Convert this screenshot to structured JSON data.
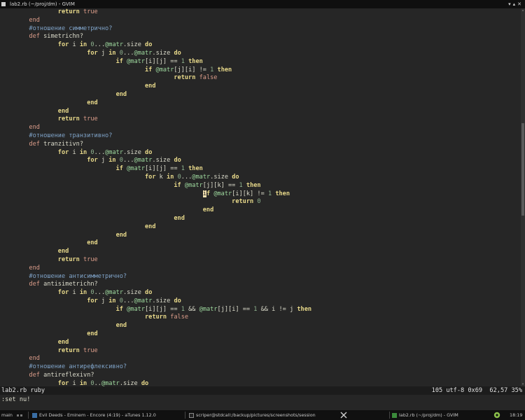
{
  "window": {
    "title": "lab2.rb (~/proj/dm) - GVIM",
    "controls": "▾▴✕"
  },
  "editor": {
    "lines": [
      [
        {
          "t": "                "
        },
        {
          "t": "return",
          "c": "kw"
        },
        {
          "t": " "
        },
        {
          "t": "true",
          "c": "bool"
        }
      ],
      [
        {
          "t": "        "
        },
        {
          "t": "end",
          "c": "bool"
        }
      ],
      [
        {
          "t": "        "
        },
        {
          "t": "#отношение симметрично?",
          "c": "cmt"
        }
      ],
      [
        {
          "t": "        "
        },
        {
          "t": "def",
          "c": "bool"
        },
        {
          "t": " simetrichn?"
        }
      ],
      [
        {
          "t": "                "
        },
        {
          "t": "for",
          "c": "kw"
        },
        {
          "t": " i "
        },
        {
          "t": "in",
          "c": "kw"
        },
        {
          "t": " "
        },
        {
          "t": "0",
          "c": "num"
        },
        {
          "t": "..."
        },
        {
          "t": "@matr",
          "c": "ivar"
        },
        {
          "t": ".size "
        },
        {
          "t": "do",
          "c": "kw"
        }
      ],
      [
        {
          "t": "                        "
        },
        {
          "t": "for",
          "c": "kw"
        },
        {
          "t": " j "
        },
        {
          "t": "in",
          "c": "kw"
        },
        {
          "t": " "
        },
        {
          "t": "0",
          "c": "num"
        },
        {
          "t": "..."
        },
        {
          "t": "@matr",
          "c": "ivar"
        },
        {
          "t": ".size "
        },
        {
          "t": "do",
          "c": "kw"
        }
      ],
      [
        {
          "t": "                                "
        },
        {
          "t": "if",
          "c": "kw"
        },
        {
          "t": " "
        },
        {
          "t": "@matr",
          "c": "ivar"
        },
        {
          "t": "[i][j] == "
        },
        {
          "t": "1",
          "c": "num"
        },
        {
          "t": " "
        },
        {
          "t": "then",
          "c": "kw"
        }
      ],
      [
        {
          "t": "                                        "
        },
        {
          "t": "if",
          "c": "kw"
        },
        {
          "t": " "
        },
        {
          "t": "@matr",
          "c": "ivar"
        },
        {
          "t": "[j][i] != "
        },
        {
          "t": "1",
          "c": "num"
        },
        {
          "t": " "
        },
        {
          "t": "then",
          "c": "kw"
        }
      ],
      [
        {
          "t": "                                                "
        },
        {
          "t": "return",
          "c": "kw"
        },
        {
          "t": " "
        },
        {
          "t": "false",
          "c": "bool"
        }
      ],
      [
        {
          "t": "                                        "
        },
        {
          "t": "end",
          "c": "kw"
        }
      ],
      [
        {
          "t": "                                "
        },
        {
          "t": "end",
          "c": "kw"
        }
      ],
      [
        {
          "t": "                        "
        },
        {
          "t": "end",
          "c": "kw"
        }
      ],
      [
        {
          "t": "                "
        },
        {
          "t": "end",
          "c": "kw"
        }
      ],
      [
        {
          "t": "                "
        },
        {
          "t": "return",
          "c": "kw"
        },
        {
          "t": " "
        },
        {
          "t": "true",
          "c": "bool"
        }
      ],
      [
        {
          "t": "        "
        },
        {
          "t": "end",
          "c": "bool"
        }
      ],
      [
        {
          "t": "        "
        },
        {
          "t": "#отношение транзитивно?",
          "c": "cmt"
        }
      ],
      [
        {
          "t": "        "
        },
        {
          "t": "def",
          "c": "bool"
        },
        {
          "t": " tranzitivn?"
        }
      ],
      [
        {
          "t": "                "
        },
        {
          "t": "for",
          "c": "kw"
        },
        {
          "t": " i "
        },
        {
          "t": "in",
          "c": "kw"
        },
        {
          "t": " "
        },
        {
          "t": "0",
          "c": "num"
        },
        {
          "t": "..."
        },
        {
          "t": "@matr",
          "c": "ivar"
        },
        {
          "t": ".size "
        },
        {
          "t": "do",
          "c": "kw"
        }
      ],
      [
        {
          "t": "                        "
        },
        {
          "t": "for",
          "c": "kw"
        },
        {
          "t": " j "
        },
        {
          "t": "in",
          "c": "kw"
        },
        {
          "t": " "
        },
        {
          "t": "0",
          "c": "num"
        },
        {
          "t": "..."
        },
        {
          "t": "@matr",
          "c": "ivar"
        },
        {
          "t": ".size "
        },
        {
          "t": "do",
          "c": "kw"
        }
      ],
      [
        {
          "t": "                                "
        },
        {
          "t": "if",
          "c": "kw"
        },
        {
          "t": " "
        },
        {
          "t": "@matr",
          "c": "ivar"
        },
        {
          "t": "[i][j] == "
        },
        {
          "t": "1",
          "c": "num"
        },
        {
          "t": " "
        },
        {
          "t": "then",
          "c": "kw"
        }
      ],
      [
        {
          "t": "                                        "
        },
        {
          "t": "for",
          "c": "kw"
        },
        {
          "t": " k "
        },
        {
          "t": "in",
          "c": "kw"
        },
        {
          "t": " "
        },
        {
          "t": "0",
          "c": "num"
        },
        {
          "t": "..."
        },
        {
          "t": "@matr",
          "c": "ivar"
        },
        {
          "t": ".size "
        },
        {
          "t": "do",
          "c": "kw"
        }
      ],
      [
        {
          "t": "                                                "
        },
        {
          "t": "if",
          "c": "kw"
        },
        {
          "t": " "
        },
        {
          "t": "@matr",
          "c": "ivar"
        },
        {
          "t": "[j][k] == "
        },
        {
          "t": "1",
          "c": "num"
        },
        {
          "t": " "
        },
        {
          "t": "then",
          "c": "kw"
        }
      ],
      [
        {
          "t": "                                                        "
        },
        {
          "t": "i",
          "c": "cursor"
        },
        {
          "t": "f",
          "c": "kw"
        },
        {
          "t": " "
        },
        {
          "t": "@matr",
          "c": "ivar"
        },
        {
          "t": "[i][k] != "
        },
        {
          "t": "1",
          "c": "num"
        },
        {
          "t": " "
        },
        {
          "t": "then",
          "c": "kw"
        }
      ],
      [
        {
          "t": "                                                                "
        },
        {
          "t": "return",
          "c": "kw"
        },
        {
          "t": " "
        },
        {
          "t": "0",
          "c": "num"
        }
      ],
      [
        {
          "t": "                                                        "
        },
        {
          "t": "end",
          "c": "kw"
        }
      ],
      [
        {
          "t": "                                                "
        },
        {
          "t": "end",
          "c": "kw"
        }
      ],
      [
        {
          "t": "                                        "
        },
        {
          "t": "end",
          "c": "kw"
        }
      ],
      [
        {
          "t": "                                "
        },
        {
          "t": "end",
          "c": "kw"
        }
      ],
      [
        {
          "t": "                        "
        },
        {
          "t": "end",
          "c": "kw"
        }
      ],
      [
        {
          "t": "                "
        },
        {
          "t": "end",
          "c": "kw"
        }
      ],
      [
        {
          "t": "                "
        },
        {
          "t": "return",
          "c": "kw"
        },
        {
          "t": " "
        },
        {
          "t": "true",
          "c": "bool"
        }
      ],
      [
        {
          "t": "        "
        },
        {
          "t": "end",
          "c": "bool"
        }
      ],
      [
        {
          "t": "        "
        },
        {
          "t": "#отношение антисимметрично?",
          "c": "cmt"
        }
      ],
      [
        {
          "t": "        "
        },
        {
          "t": "def",
          "c": "bool"
        },
        {
          "t": " antisimetrichn?"
        }
      ],
      [
        {
          "t": "                "
        },
        {
          "t": "for",
          "c": "kw"
        },
        {
          "t": " i "
        },
        {
          "t": "in",
          "c": "kw"
        },
        {
          "t": " "
        },
        {
          "t": "0",
          "c": "num"
        },
        {
          "t": "..."
        },
        {
          "t": "@matr",
          "c": "ivar"
        },
        {
          "t": ".size "
        },
        {
          "t": "do",
          "c": "kw"
        }
      ],
      [
        {
          "t": "                        "
        },
        {
          "t": "for",
          "c": "kw"
        },
        {
          "t": " j "
        },
        {
          "t": "in",
          "c": "kw"
        },
        {
          "t": " "
        },
        {
          "t": "0",
          "c": "num"
        },
        {
          "t": "..."
        },
        {
          "t": "@matr",
          "c": "ivar"
        },
        {
          "t": ".size "
        },
        {
          "t": "do",
          "c": "kw"
        }
      ],
      [
        {
          "t": "                                "
        },
        {
          "t": "if",
          "c": "kw"
        },
        {
          "t": " "
        },
        {
          "t": "@matr",
          "c": "ivar"
        },
        {
          "t": "[i][j] == "
        },
        {
          "t": "1",
          "c": "num"
        },
        {
          "t": " && "
        },
        {
          "t": "@matr",
          "c": "ivar"
        },
        {
          "t": "[j][i] == "
        },
        {
          "t": "1",
          "c": "num"
        },
        {
          "t": " && i != j "
        },
        {
          "t": "then",
          "c": "kw"
        }
      ],
      [
        {
          "t": "                                        "
        },
        {
          "t": "return",
          "c": "kw"
        },
        {
          "t": " "
        },
        {
          "t": "false",
          "c": "bool"
        }
      ],
      [
        {
          "t": "                                "
        },
        {
          "t": "end",
          "c": "kw"
        }
      ],
      [
        {
          "t": "                        "
        },
        {
          "t": "end",
          "c": "kw"
        }
      ],
      [
        {
          "t": "                "
        },
        {
          "t": "end",
          "c": "kw"
        }
      ],
      [
        {
          "t": "                "
        },
        {
          "t": "return",
          "c": "kw"
        },
        {
          "t": " "
        },
        {
          "t": "true",
          "c": "bool"
        }
      ],
      [
        {
          "t": "        "
        },
        {
          "t": "end",
          "c": "bool"
        }
      ],
      [
        {
          "t": "        "
        },
        {
          "t": "#отношение антирефлексивно?",
          "c": "cmt"
        }
      ],
      [
        {
          "t": "        "
        },
        {
          "t": "def",
          "c": "bool"
        },
        {
          "t": " antireflexivn?"
        }
      ],
      [
        {
          "t": "                "
        },
        {
          "t": "for",
          "c": "kw"
        },
        {
          "t": " i "
        },
        {
          "t": "in",
          "c": "kw"
        },
        {
          "t": " "
        },
        {
          "t": "0",
          "c": "num"
        },
        {
          "t": ".."
        },
        {
          "t": "@matr",
          "c": "ivar"
        },
        {
          "t": ".size "
        },
        {
          "t": "do",
          "c": "kw"
        }
      ]
    ]
  },
  "scrollbar": {
    "up_glyph": "▴",
    "down_glyph": "▾",
    "position": 0.3,
    "visible": 0.25
  },
  "statusline": {
    "left": "lab2.rb ruby",
    "right": "105 utf-8 0x69  62,57 35%"
  },
  "cmdline": {
    "text": ":set nu!"
  },
  "taskbar": {
    "workspace": "main",
    "player": "Evil Deeds - Eminem - Encore (4:19) - aTunes 1.12.0",
    "terminal": "scriper@stdcall:/backup/pictures/screenshots/session",
    "gvim": "lab2.rb (~/proj/dm) - GVIM",
    "clock": "18:19"
  },
  "colors": {
    "background": "#262626",
    "keyword": "#e8d98a",
    "comment": "#7fa3c8",
    "number": "#8fb28f",
    "ivar": "#9ed99e",
    "boolean": "#dc9d8a"
  }
}
